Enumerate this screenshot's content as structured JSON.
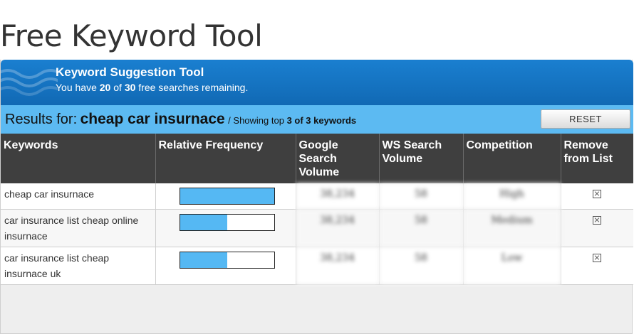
{
  "page": {
    "title": "Free Keyword Tool"
  },
  "header": {
    "title": "Keyword Suggestion Tool",
    "searches_prefix": "You have",
    "searches_used": "20",
    "searches_of": "of",
    "searches_total": "30",
    "searches_suffix": "free searches remaining."
  },
  "results": {
    "label": "Results for:",
    "query": "cheap car insurnace",
    "showing_prefix": "/ Showing top",
    "showing_count": "3 of 3",
    "showing_suffix": "keywords",
    "reset_label": "RESET"
  },
  "colors": {
    "header_blue": "#1a7fd0",
    "results_bar": "#5cbaf2",
    "table_header": "#3f3f3f",
    "bar_fill": "#55b8f3"
  },
  "table": {
    "headers": {
      "keywords": "Keywords",
      "frequency": "Relative Frequency",
      "google": "Google Search Volume",
      "ws": "WS Search Volume",
      "competition": "Competition",
      "remove": "Remove from List"
    },
    "rows": [
      {
        "keyword": "cheap car insurnace",
        "frequency": 1.0,
        "google": "38,234",
        "ws": "58",
        "competition": "High",
        "remove_icon": "close-box-icon"
      },
      {
        "keyword": "car insurance list cheap online insurnace",
        "frequency": 0.5,
        "google": "38,234",
        "ws": "58",
        "competition": "Medium",
        "remove_icon": "close-box-icon"
      },
      {
        "keyword": "car insurance list cheap insurnace uk",
        "frequency": 0.5,
        "google": "38,234",
        "ws": "58",
        "competition": "Low",
        "remove_icon": "close-box-icon"
      }
    ]
  }
}
